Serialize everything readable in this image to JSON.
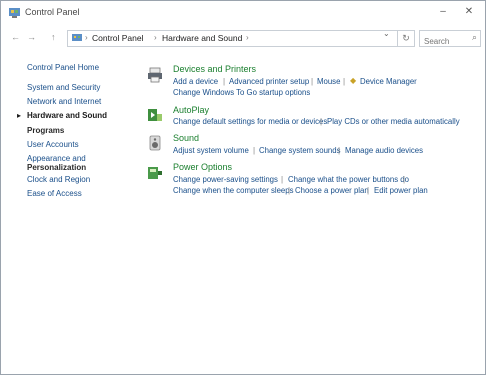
{
  "window": {
    "title": "Control Panel",
    "minimize": "–",
    "close": "✕"
  },
  "address": {
    "back": "←",
    "forward": "→",
    "up": "↑",
    "crumbs": [
      "Control Panel",
      "Hardware and Sound"
    ],
    "dropdown": "⌄",
    "refresh": "↻",
    "search_placeholder": "Search",
    "search_icon": "search-icon"
  },
  "sidebar": {
    "items": [
      {
        "label": "Control Panel Home",
        "kind": "link"
      },
      {
        "label": "System and Security",
        "kind": "link"
      },
      {
        "label": "Network and Internet",
        "kind": "link"
      },
      {
        "label": "Hardware and Sound",
        "kind": "current"
      },
      {
        "label": "Programs",
        "kind": "header"
      },
      {
        "label": "User Accounts",
        "kind": "link"
      },
      {
        "label": "Appearance and",
        "kind": "link"
      },
      {
        "label": "Personalization",
        "kind": "header"
      },
      {
        "label": "Clock and Region",
        "kind": "link"
      },
      {
        "label": "Ease of Access",
        "kind": "link"
      }
    ]
  },
  "main": {
    "categories": [
      {
        "icon": "printer-icon",
        "title": "Devices and Printers",
        "rows": [
          [
            "Add a device",
            "Advanced printer setup",
            "Mouse",
            "Device Manager"
          ],
          [
            "Change Windows To Go startup options"
          ]
        ]
      },
      {
        "icon": "autoplay-icon",
        "title": "AutoPlay",
        "rows": [
          [
            "Change default settings for media or devices",
            "Play CDs or other media automatically"
          ]
        ]
      },
      {
        "icon": "speaker-icon",
        "title": "Sound",
        "rows": [
          [
            "Adjust system volume",
            "Change system sounds",
            "Manage audio devices"
          ]
        ]
      },
      {
        "icon": "power-icon",
        "title": "Power Options",
        "rows": [
          [
            "Change power-saving settings",
            "Change what the power buttons do"
          ],
          [
            "Change when the computer sleeps",
            "Choose a power plan",
            "Edit power plan"
          ]
        ]
      }
    ]
  }
}
